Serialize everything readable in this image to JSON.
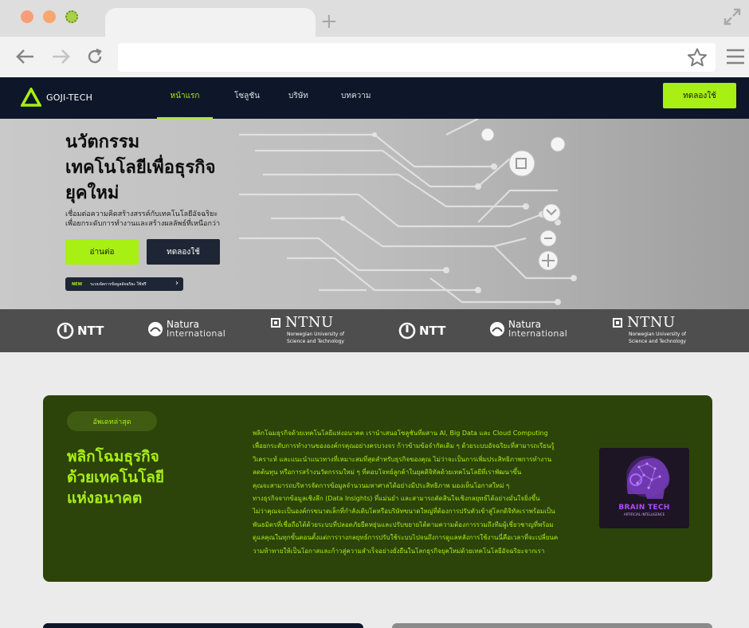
{
  "browser": {
    "url": "",
    "colors": {
      "tabbar": "#dedede",
      "toolbar": "#f2f2f2"
    }
  },
  "nav": {
    "brand": "GOJI-TECH",
    "links": [
      "หน้าแรก",
      "โซลูชัน",
      "บริษัท",
      "บทความ"
    ],
    "active_index": 0,
    "cta": "ทดลองใช้",
    "accent": "#a8ef14",
    "background": "#0e1729"
  },
  "hero": {
    "title_lines": [
      "นวัตกรรม",
      "เทคโนโลยีเพื่อธุรกิจ",
      "ยุคใหม่"
    ],
    "subtitle_lines": [
      "เชื่อมต่อความคิดสร้างสรรค์กับเทคโนโลยีอัจฉริยะ",
      "เพื่อยกระดับการทำงานและสร้างผลลัพธ์ที่เหนือกว่า"
    ],
    "primary_button": "อ่านต่อ",
    "secondary_button": "ทดลองใช้",
    "announcement_badge": "NEW",
    "announcement_text": "ระบบจัดการข้อมูลอัจฉริยะ ใช้ฟรี"
  },
  "partners": [
    {
      "type": "ntt",
      "name": "NTT"
    },
    {
      "type": "natura",
      "name": "Natura",
      "sub": "International"
    },
    {
      "type": "ntnu",
      "name": "NTNU",
      "sub1": "Norwegian University of",
      "sub2": "Science and Technology"
    },
    {
      "type": "ntt",
      "name": "NTT"
    },
    {
      "type": "natura",
      "name": "Natura",
      "sub": "International"
    },
    {
      "type": "ntnu",
      "name": "NTNU",
      "sub1": "Norwegian University of",
      "sub2": "Science and Technology"
    }
  ],
  "feature": {
    "badge": "อัพเดทล่าสุด",
    "title_lines": [
      "พลิกโฉมธุรกิจ",
      "ด้วยเทคโนโลยี",
      "แห่งอนาคต"
    ],
    "body_lines": [
      "พลิกโฉมธุรกิจด้วยเทคโนโลยีแห่งอนาคต เรานำเสนอโซลูชันที่ผสาน AI, Big Data และ Cloud Computing",
      "เพื่อยกระดับการทำงานขององค์กรคุณอย่างครบวงจร ก้าวข้ามข้อจำกัดเดิม ๆ ด้วยระบบอัจฉริยะที่สามารถเรียนรู้",
      "วิเคราะห์ และแนะนำแนวทางที่เหมาะสมที่สุดสำหรับธุรกิจของคุณ ไม่ว่าจะเป็นการเพิ่มประสิทธิภาพการทำงาน",
      "ลดต้นทุน หรือการสร้างนวัตกรรมใหม่ ๆ ที่ตอบโจทย์ลูกค้าในยุคดิจิทัลด้วยเทคโนโลยีที่เราพัฒนาขึ้น",
      "คุณจะสามารถบริหารจัดการข้อมูลจำนวนมหาศาลได้อย่างมีประสิทธิภาพ มองเห็นโอกาสใหม่ ๆ",
      "ทางธุรกิจจากข้อมูลเชิงลึก (Data Insights) ที่แม่นยำ และสามารถตัดสินใจเชิงกลยุทธ์ได้อย่างมั่นใจยิ่งขึ้น",
      "ไม่ว่าคุณจะเป็นองค์กรขนาดเล็กที่กำลังเติบโตหรือบริษัทขนาดใหญ่ที่ต้องการปรับตัวเข้าสู่โลกดิจิทัลเราพร้อมเป็น",
      "พันธมิตรที่เชื่อถือได้ด้วยระบบที่ปลอดภัยยืดหยุ่นและปรับขยายได้ตามความต้องการรวมถึงทีมผู้เชี่ยวชาญที่พร้อม",
      "ดูแลคุณในทุกขั้นตอนตั้งแต่การวางกลยุทธ์การปรับใช้ระบบไปจนถึงการดูแลหลังการใช้งานนี่คือเวลาที่จะเปลี่ยนค",
      "วามท้าทายให้เป็นโอกาสและก้าวสู่ความสำเร็จอย่างยั่งยืนในโลกธุรกิจยุคใหม่ด้วยเทคโนโลยีอัจฉริยะจากเรา"
    ],
    "image_title": "BRAIN TECH",
    "image_subtitle": "ARTIFICIAL INTELLIGENCE",
    "colors": {
      "card": "#2c430a",
      "text": "#a8ef14"
    }
  }
}
